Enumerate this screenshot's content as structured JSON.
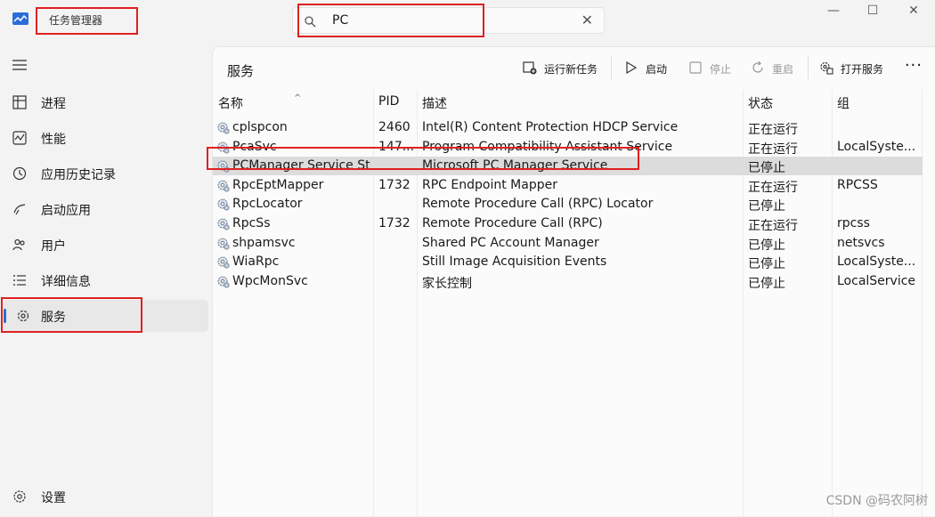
{
  "app": {
    "title": "任务管理器"
  },
  "search": {
    "value": "PC",
    "clear_icon": "close-icon"
  },
  "window_controls": {
    "minimize": "—",
    "maximize": "☐",
    "close": "✕"
  },
  "sidebar": {
    "items": [
      {
        "label": "进程",
        "icon": "processes-icon"
      },
      {
        "label": "性能",
        "icon": "performance-icon"
      },
      {
        "label": "应用历史记录",
        "icon": "history-icon"
      },
      {
        "label": "启动应用",
        "icon": "startup-icon"
      },
      {
        "label": "用户",
        "icon": "users-icon"
      },
      {
        "label": "详细信息",
        "icon": "details-icon"
      },
      {
        "label": "服务",
        "icon": "services-icon",
        "active": true
      }
    ],
    "settings_label": "设置"
  },
  "main": {
    "title": "服务",
    "toolbar": {
      "new_task": "运行新任务",
      "start": "启动",
      "stop": "停止",
      "restart": "重启",
      "open_services": "打开服务",
      "more": "···"
    }
  },
  "table": {
    "columns": [
      "名称",
      "PID",
      "描述",
      "状态",
      "组"
    ],
    "rows": [
      {
        "name": "cplspcon",
        "pid": "2460",
        "desc": "Intel(R) Content Protection HDCP Service",
        "status": "正在运行",
        "group": ""
      },
      {
        "name": "PcaSvc",
        "pid": "147...",
        "desc": "Program Compatibility Assistant Service",
        "status": "正在运行",
        "group": "LocalSyste..."
      },
      {
        "name": "PCManager Service St...",
        "pid": "",
        "desc": "Microsoft PC Manager Service",
        "status": "已停止",
        "group": "",
        "selected": true
      },
      {
        "name": "RpcEptMapper",
        "pid": "1732",
        "desc": "RPC Endpoint Mapper",
        "status": "正在运行",
        "group": "RPCSS"
      },
      {
        "name": "RpcLocator",
        "pid": "",
        "desc": "Remote Procedure Call (RPC) Locator",
        "status": "已停止",
        "group": ""
      },
      {
        "name": "RpcSs",
        "pid": "1732",
        "desc": "Remote Procedure Call (RPC)",
        "status": "正在运行",
        "group": "rpcss"
      },
      {
        "name": "shpamsvc",
        "pid": "",
        "desc": "Shared PC Account Manager",
        "status": "已停止",
        "group": "netsvcs"
      },
      {
        "name": "WiaRpc",
        "pid": "",
        "desc": "Still Image Acquisition Events",
        "status": "已停止",
        "group": "LocalSyste..."
      },
      {
        "name": "WpcMonSvc",
        "pid": "",
        "desc": "家长控制",
        "status": "已停止",
        "group": "LocalService"
      }
    ]
  },
  "watermark": "CSDN @码农阿树",
  "colors": {
    "accent": "#2b6dd6",
    "highlight_box": "#e02020",
    "selected_row": "#dcdcdc"
  }
}
